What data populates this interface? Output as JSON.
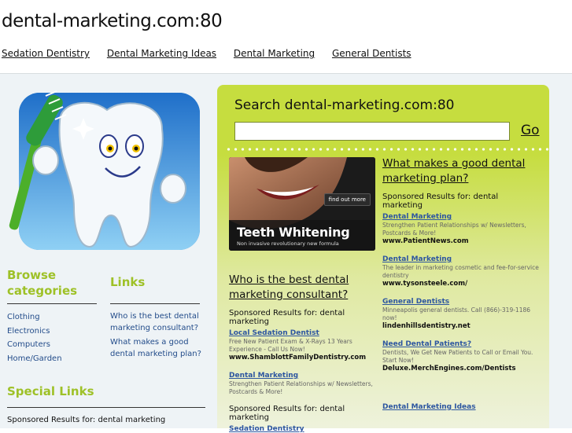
{
  "header": {
    "domain": "dental-marketing.com:80",
    "nav": [
      "Sedation Dentistry",
      "Dental Marketing Ideas",
      "Dental Marketing",
      "General Dentists"
    ]
  },
  "left": {
    "browse_title": "Browse categories",
    "categories": [
      "Clothing",
      "Electronics",
      "Computers",
      "Home/Garden"
    ],
    "links_title": "Links",
    "links": [
      "Who is the best dental marketing consultant?",
      "What makes a good dental marketing plan?"
    ],
    "special_title": "Special Links",
    "sponsored": "Sponsored Results for: dental marketing"
  },
  "search": {
    "title": "Search dental-marketing.com:80",
    "value": "",
    "go_label": "Go"
  },
  "ad": {
    "cta": "find out more",
    "brand": "Teeth Whitening",
    "tagline": "Non invasive revolutionary new formula"
  },
  "block1": {
    "question": "What makes a good dental marketing plan?",
    "sponsored": "Sponsored Results for: dental marketing",
    "results": [
      {
        "title": "Dental Marketing",
        "desc": "Strengthen Patient Relationships w/ Newsletters, Postcards & More!",
        "url": "www.PatientNews.com"
      },
      {
        "title": "Dental Marketing",
        "desc": "The leader in marketing cosmetic and fee-for-service dentistry",
        "url": "www.tysonsteele.com/"
      },
      {
        "title": "General Dentists",
        "desc": "Minneapolis general dentists. Call (866)-319-1186 now!",
        "url": "lindenhillsdentistry.net"
      },
      {
        "title": "Need Dental Patients?",
        "desc": "Dentists, We Get New Patients to Call or Email You. Start Now!",
        "url": "Deluxe.MerchEngines.com/Dentists"
      },
      {
        "title": "Dental Marketing Ideas",
        "desc": "",
        "url": ""
      }
    ]
  },
  "block2": {
    "question": "Who is the best dental marketing consultant?",
    "sponsored": "Sponsored Results for: dental marketing",
    "results": [
      {
        "title": "Local Sedation Dentist",
        "desc": "Free New Patient Exam & X-Rays 13 Years Experience - Call Us Now!",
        "url": "www.ShamblottFamilyDentistry.com"
      },
      {
        "title": "Dental Marketing",
        "desc": "Strengthen Patient Relationships w/ Newsletters, Postcards & More!",
        "url": ""
      }
    ],
    "sponsored2": "Sponsored Results for: dental marketing",
    "results2": [
      {
        "title": "Sedation Dentistry",
        "desc": "",
        "url": ""
      }
    ]
  },
  "colors": {
    "accent_green": "#9ec127",
    "panel_green": "#c6dd3f",
    "link_blue": "#2d56a0"
  }
}
